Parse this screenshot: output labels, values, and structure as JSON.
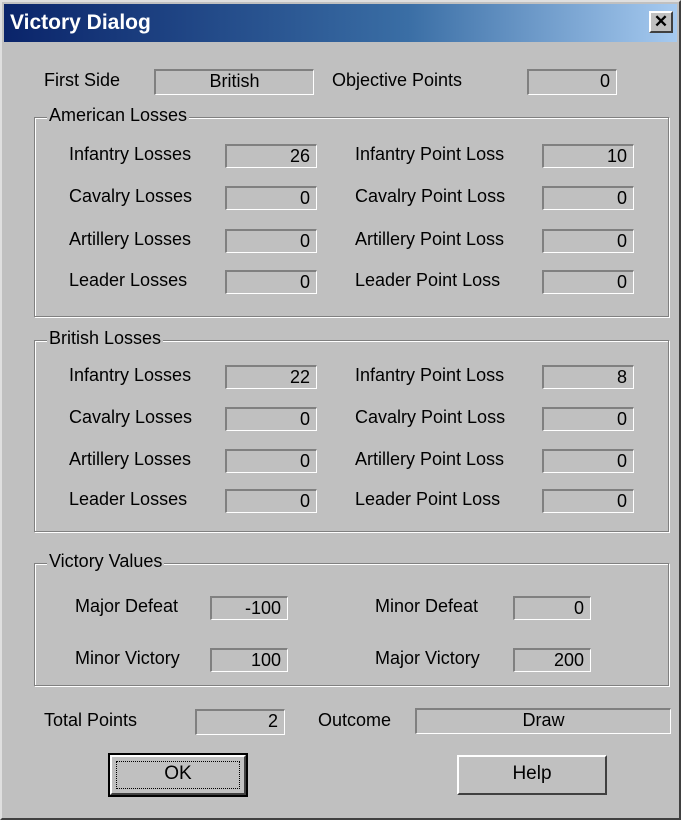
{
  "window": {
    "title": "Victory Dialog",
    "close_glyph": "✕"
  },
  "header": {
    "first_side_label": "First Side",
    "first_side_value": "British",
    "objective_points_label": "Objective Points",
    "objective_points_value": "0"
  },
  "american": {
    "title": "American Losses",
    "infantry_losses_label": "Infantry Losses",
    "infantry_losses": "26",
    "cavalry_losses_label": "Cavalry Losses",
    "cavalry_losses": "0",
    "artillery_losses_label": "Artillery Losses",
    "artillery_losses": "0",
    "leader_losses_label": "Leader Losses",
    "leader_losses": "0",
    "infantry_point_label": "Infantry Point Loss",
    "infantry_point": "10",
    "cavalry_point_label": "Cavalry Point Loss",
    "cavalry_point": "0",
    "artillery_point_label": "Artillery Point Loss",
    "artillery_point": "0",
    "leader_point_label": "Leader Point Loss",
    "leader_point": "0"
  },
  "british": {
    "title": "British Losses",
    "infantry_losses_label": "Infantry Losses",
    "infantry_losses": "22",
    "cavalry_losses_label": "Cavalry Losses",
    "cavalry_losses": "0",
    "artillery_losses_label": "Artillery Losses",
    "artillery_losses": "0",
    "leader_losses_label": "Leader Losses",
    "leader_losses": "0",
    "infantry_point_label": "Infantry Point Loss",
    "infantry_point": "8",
    "cavalry_point_label": "Cavalry Point Loss",
    "cavalry_point": "0",
    "artillery_point_label": "Artillery Point Loss",
    "artillery_point": "0",
    "leader_point_label": "Leader Point Loss",
    "leader_point": "0"
  },
  "victory": {
    "title": "Victory Values",
    "major_defeat_label": "Major Defeat",
    "major_defeat": "-100",
    "minor_defeat_label": "Minor Defeat",
    "minor_defeat": "0",
    "minor_victory_label": "Minor Victory",
    "minor_victory": "100",
    "major_victory_label": "Major Victory",
    "major_victory": "200"
  },
  "totals": {
    "total_points_label": "Total Points",
    "total_points": "2",
    "outcome_label": "Outcome",
    "outcome": "Draw"
  },
  "buttons": {
    "ok": "OK",
    "help": "Help"
  }
}
